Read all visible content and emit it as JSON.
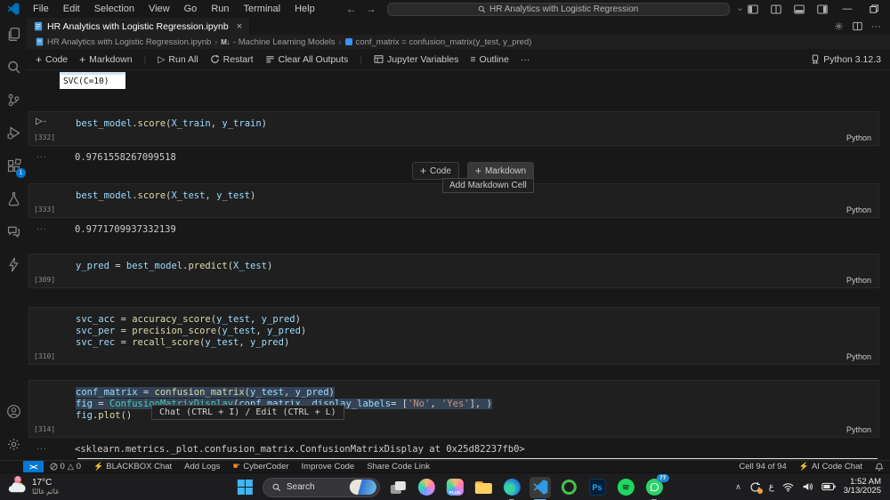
{
  "colors": {
    "accent_blue": "#0078d4",
    "editor_bg": "#181818",
    "cell_bg": "#1f1f1f",
    "token_variable": "#9cdcfe",
    "token_function": "#dcdcaa",
    "token_class": "#4ec9b0",
    "token_string": "#ce9178",
    "status_bolt": "#e8a33d",
    "whatsapp_green": "#2bd46a"
  },
  "title_bar": {
    "menus": [
      "File",
      "Edit",
      "Selection",
      "View",
      "Go",
      "Run",
      "Terminal",
      "Help"
    ],
    "search_text": "HR Analytics with Logistic Regression"
  },
  "activity_bar": {
    "extensions_badge": "1"
  },
  "editor": {
    "tab_title": "HR Analytics with Logistic Regression.ipynb",
    "breadcrumb": {
      "file": "HR Analytics with Logistic Regression.ipynb",
      "markdown_icon": "M↓",
      "section": "- Machine Learning Models",
      "symbol": "conf_matrix = confusion_matrix(y_test, y_pred)"
    }
  },
  "toolbar": {
    "code": "Code",
    "markdown": "Markdown",
    "run_all": "Run All",
    "restart": "Restart",
    "clear_outputs": "Clear All Outputs",
    "jupyter_variables": "Jupyter Variables",
    "outline": "Outline",
    "more": "···",
    "kernel": "Python 3.12.3"
  },
  "notebook": {
    "stray_output": "SVC(C=10)",
    "add_cell": {
      "code": "Code",
      "markdown": "Markdown",
      "tooltip": "Add Markdown Cell"
    },
    "chat_hint": "Chat (CTRL + I) / Edit (CTRL + L)",
    "cells": [
      {
        "exec": "[332]",
        "lang": "Python",
        "gap_above": 25,
        "show_run": true,
        "lines": [
          [
            [
              "v",
              "best_model"
            ],
            [
              "p",
              "."
            ],
            [
              "f",
              "score"
            ],
            [
              "p",
              "("
            ],
            [
              "v",
              "X_train"
            ],
            [
              "p",
              ", "
            ],
            [
              "v",
              "y_train"
            ],
            [
              "p",
              ")"
            ]
          ]
        ],
        "output": "0.9761558267099518"
      },
      {
        "exec": "[333]",
        "lang": "Python",
        "gap_above": 20,
        "lines": [
          [
            [
              "v",
              "best_model"
            ],
            [
              "p",
              "."
            ],
            [
              "f",
              "score"
            ],
            [
              "p",
              "("
            ],
            [
              "v",
              "X_test"
            ],
            [
              "p",
              ", "
            ],
            [
              "v",
              "y_test"
            ],
            [
              "p",
              ")"
            ]
          ]
        ],
        "output": "0.9771709937332139"
      },
      {
        "exec": "[309]",
        "lang": "Python",
        "gap_above": 18,
        "lines": [
          [
            [
              "v",
              "y_pred"
            ],
            [
              "p",
              " = "
            ],
            [
              "v",
              "best_model"
            ],
            [
              "p",
              "."
            ],
            [
              "f",
              "predict"
            ],
            [
              "p",
              "("
            ],
            [
              "v",
              "X_test"
            ],
            [
              "p",
              ")"
            ]
          ]
        ]
      },
      {
        "exec": "[310]",
        "lang": "Python",
        "gap_above": 21,
        "lines": [
          [
            [
              "v",
              "svc_acc"
            ],
            [
              "p",
              " = "
            ],
            [
              "f",
              "accuracy_score"
            ],
            [
              "p",
              "("
            ],
            [
              "v",
              "y_test"
            ],
            [
              "p",
              ", "
            ],
            [
              "v",
              "y_pred"
            ],
            [
              "p",
              ")"
            ]
          ],
          [
            [
              "v",
              "svc_per"
            ],
            [
              "p",
              " = "
            ],
            [
              "f",
              "precision_score"
            ],
            [
              "p",
              "("
            ],
            [
              "v",
              "y_test"
            ],
            [
              "p",
              ", "
            ],
            [
              "v",
              "y_pred"
            ],
            [
              "p",
              ")"
            ]
          ],
          [
            [
              "v",
              "svc_rec"
            ],
            [
              "p",
              " = "
            ],
            [
              "f",
              "recall_score"
            ],
            [
              "p",
              "("
            ],
            [
              "v",
              "y_test"
            ],
            [
              "p",
              ", "
            ],
            [
              "v",
              "y_pred"
            ],
            [
              "p",
              ")"
            ]
          ]
        ]
      },
      {
        "exec": "[314]",
        "lang": "Python",
        "gap_above": 17,
        "selected": [
          0,
          1
        ],
        "lines": [
          [
            [
              "v",
              "conf_matrix"
            ],
            [
              "p",
              " = "
            ],
            [
              "f",
              "confusion_matrix"
            ],
            [
              "p",
              "("
            ],
            [
              "v",
              "y_test"
            ],
            [
              "p",
              ", "
            ],
            [
              "v",
              "y_pred"
            ],
            [
              "p",
              ")"
            ]
          ],
          [
            [
              "v",
              "fig"
            ],
            [
              "p",
              " = "
            ],
            [
              "c",
              "ConfusionMatrixDisplay"
            ],
            [
              "p",
              "("
            ],
            [
              "v",
              "conf_matrix"
            ],
            [
              "p",
              ", "
            ],
            [
              "v",
              "display_labels"
            ],
            [
              "p",
              "= ["
            ],
            [
              "s",
              "'No'"
            ],
            [
              "p",
              ", "
            ],
            [
              "s",
              "'Yes'"
            ],
            [
              "p",
              "], )"
            ]
          ],
          [
            [
              "v",
              "fig"
            ],
            [
              "p",
              "."
            ],
            [
              "f",
              "plot"
            ],
            [
              "p",
              "()"
            ]
          ]
        ],
        "output": "<sklearn.metrics._plot.confusion_matrix.ConfusionMatrixDisplay at 0x25d82237fb0>"
      }
    ]
  },
  "status_bar": {
    "error_count": "0",
    "warning_count": "0",
    "blackbox": "BLACKBOX Chat",
    "add_logs": "Add Logs",
    "cybercoder": "CyberCoder",
    "improve": "Improve Code",
    "share": "Share Code Link",
    "cell_pos": "Cell 94 of 94",
    "ai_chat": "AI Code Chat"
  },
  "taskbar": {
    "weather_temp": "17°C",
    "weather_desc": "غائم غالبًا",
    "search_label": "Search",
    "plus_label": "PLUS",
    "ps_label": "Ps",
    "whatsapp_badge": "77",
    "lang_indicator": "ع",
    "tray_time": "1:52 AM",
    "tray_date": "3/13/2025"
  }
}
